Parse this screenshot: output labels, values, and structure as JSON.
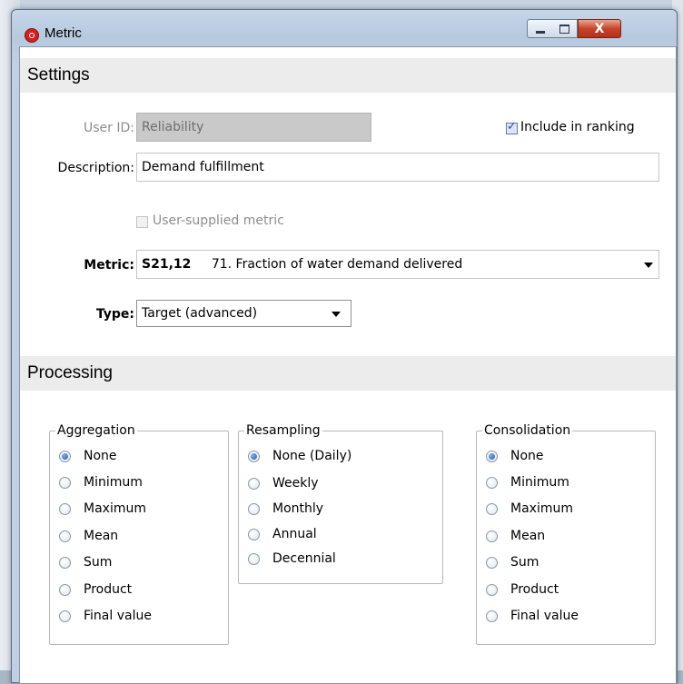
{
  "window": {
    "title": "Metric",
    "controls": {
      "minimize": "minimize",
      "maximize": "maximize",
      "close": "X"
    }
  },
  "settings": {
    "header": "Settings",
    "user_id": {
      "label": "User ID:",
      "value": "Reliability"
    },
    "include_in_ranking": {
      "label": "Include in ranking",
      "checked": true
    },
    "description": {
      "label": "Description:",
      "value": "Demand fulfillment"
    },
    "user_supplied_metric": {
      "label": "User-supplied metric",
      "checked": false
    },
    "metric": {
      "label": "Metric:",
      "code": "S21,12",
      "value": "71. Fraction of water demand delivered"
    },
    "type": {
      "label": "Type:",
      "value": "Target (advanced)"
    }
  },
  "processing": {
    "header": "Processing",
    "aggregation": {
      "title": "Aggregation",
      "options": [
        "None",
        "Minimum",
        "Maximum",
        "Mean",
        "Sum",
        "Product",
        "Final value"
      ],
      "selected": "None"
    },
    "resampling": {
      "title": "Resampling",
      "options": [
        "None (Daily)",
        "Weekly",
        "Monthly",
        "Annual",
        "Decennial"
      ],
      "selected": "None (Daily)"
    },
    "consolidation": {
      "title": "Consolidation",
      "options": [
        "None",
        "Minimum",
        "Maximum",
        "Mean",
        "Sum",
        "Product",
        "Final value"
      ],
      "selected": "None"
    }
  },
  "colors": {
    "section_header_bg": "#ececec",
    "disabled_field_bg": "#c9c9c9",
    "radio_selected": "#1c5aa8",
    "close_button": "#c7442a"
  }
}
